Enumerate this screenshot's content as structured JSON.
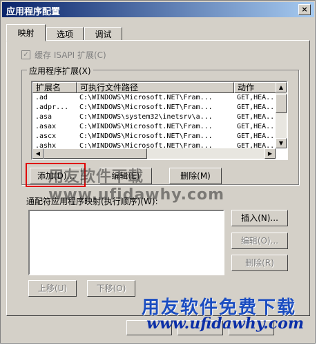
{
  "window": {
    "title": "应用程序配置",
    "close_label": "×"
  },
  "tabs": [
    {
      "label": "映射",
      "active": true
    },
    {
      "label": "选项",
      "active": false
    },
    {
      "label": "调试",
      "active": false
    }
  ],
  "cache_isapi": {
    "label": "缓存 ISAPI 扩展(C)",
    "checked": true,
    "enabled": false
  },
  "extensions_group": {
    "label": "应用程序扩展(X)"
  },
  "extensions_table": {
    "columns": [
      "扩展名",
      "可执行文件路径",
      "动作"
    ],
    "rows": [
      {
        "ext": ".ad",
        "path": "C:\\WINDOWS\\Microsoft.NET\\Fram...",
        "verbs": "GET,HEA..."
      },
      {
        "ext": ".adpr...",
        "path": "C:\\WINDOWS\\Microsoft.NET\\Fram...",
        "verbs": "GET,HEA..."
      },
      {
        "ext": ".asa",
        "path": "C:\\WINDOWS\\system32\\inetsrv\\a...",
        "verbs": "GET,HEA..."
      },
      {
        "ext": ".asax",
        "path": "C:\\WINDOWS\\Microsoft.NET\\Fram...",
        "verbs": "GET,HEA..."
      },
      {
        "ext": ".ascx",
        "path": "C:\\WINDOWS\\Microsoft.NET\\Fram...",
        "verbs": "GET,HEA..."
      },
      {
        "ext": ".ashx",
        "path": "C:\\WINDOWS\\Microsoft.NET\\Fram...",
        "verbs": "GET,HEA..."
      }
    ]
  },
  "ext_buttons": {
    "add": "添加(D)...",
    "edit": "编辑(E)",
    "remove": "删除(M)"
  },
  "wildcard": {
    "label": "通配符应用程序映射(执行顺序)(W):"
  },
  "wildcard_buttons": {
    "insert": "插入(N)...",
    "edit": "编辑(O)...",
    "remove": "删除(R)"
  },
  "order_buttons": {
    "up": "上移(U)",
    "down": "下移(O)"
  },
  "watermarks": {
    "overlay": "用友软件下载 www.ufidawhy.com",
    "brand": "用友软件免费下载",
    "url": "www.ufidawhy.com"
  }
}
